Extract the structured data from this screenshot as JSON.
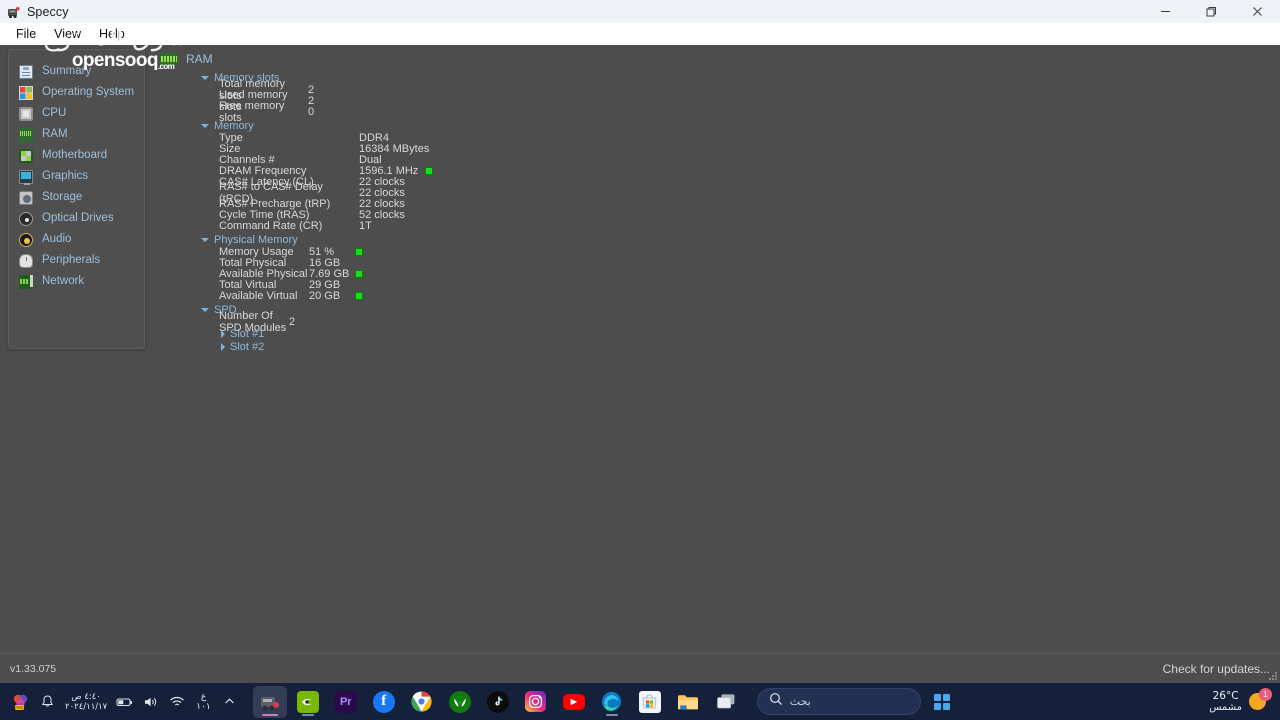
{
  "window": {
    "title": "Speccy",
    "app_icon": "speccy-icon",
    "controls": {
      "minimize": "–",
      "maximize": "❐",
      "close": "✕"
    }
  },
  "menubar": {
    "items": [
      {
        "label": "File"
      },
      {
        "label": "View"
      },
      {
        "label": "Help"
      }
    ]
  },
  "sidebar": {
    "items": [
      {
        "label": "Summary",
        "icon": "summary-icon"
      },
      {
        "label": "Operating System",
        "icon": "operating-system-icon"
      },
      {
        "label": "CPU",
        "icon": "cpu-icon"
      },
      {
        "label": "RAM",
        "icon": "ram-icon"
      },
      {
        "label": "Motherboard",
        "icon": "motherboard-icon"
      },
      {
        "label": "Graphics",
        "icon": "graphics-icon"
      },
      {
        "label": "Storage",
        "icon": "storage-icon"
      },
      {
        "label": "Optical Drives",
        "icon": "optical-drives-icon"
      },
      {
        "label": "Audio",
        "icon": "audio-icon"
      },
      {
        "label": "Peripherals",
        "icon": "peripherals-icon"
      },
      {
        "label": "Network",
        "icon": "network-icon"
      }
    ]
  },
  "content": {
    "page_title": "RAM",
    "page_icon": "ram-icon",
    "groups": {
      "memory_slots": {
        "label": "Memory slots",
        "rows": [
          {
            "key": "Total memory slots",
            "value": "2"
          },
          {
            "key": "Used memory slots",
            "value": "2"
          },
          {
            "key": "Free memory slots",
            "value": "0"
          }
        ]
      },
      "memory": {
        "label": "Memory",
        "rows": [
          {
            "key": "Type",
            "value": "DDR4"
          },
          {
            "key": "Size",
            "value": "16384 MBytes"
          },
          {
            "key": "Channels #",
            "value": "Dual"
          },
          {
            "key": "DRAM Frequency",
            "value": "1596.1 MHz",
            "led": true
          },
          {
            "key": "CAS# Latency (CL)",
            "value": "22 clocks"
          },
          {
            "key": "RAS# to CAS# Delay (tRCD)",
            "value": "22 clocks"
          },
          {
            "key": "RAS# Precharge (tRP)",
            "value": "22 clocks"
          },
          {
            "key": "Cycle Time (tRAS)",
            "value": "52 clocks"
          },
          {
            "key": "Command Rate (CR)",
            "value": "1T"
          }
        ]
      },
      "physical_memory": {
        "label": "Physical Memory",
        "rows": [
          {
            "key": "Memory Usage",
            "value": "51 %",
            "led": true
          },
          {
            "key": "Total Physical",
            "value": "16 GB"
          },
          {
            "key": "Available Physical",
            "value": "7.69 GB",
            "led": true
          },
          {
            "key": "Total Virtual",
            "value": "29 GB"
          },
          {
            "key": "Available Virtual",
            "value": "20 GB",
            "led": true
          }
        ]
      },
      "spd": {
        "label": "SPD",
        "rows": [
          {
            "key": "Number Of SPD Modules",
            "value": "2"
          }
        ],
        "slots": [
          {
            "label": "Slot #1"
          },
          {
            "label": "Slot #2"
          }
        ]
      }
    }
  },
  "statusbar": {
    "version": "v1.33.075",
    "check_updates": "Check for updates..."
  },
  "watermark": {
    "arabic": "السوق المفتوح",
    "english": "opensooq",
    "tld": ".com"
  },
  "taskbar": {
    "tray": [
      {
        "name": "onedrive-photos-icon",
        "glyph": ""
      },
      {
        "name": "notification-bell-icon",
        "glyph": "🔔"
      }
    ],
    "datetime": {
      "time": "٤:٤٠ ص",
      "date": "٢٠٢٤/١١/١٧"
    },
    "status_icons": [
      {
        "name": "battery-icon"
      },
      {
        "name": "volume-icon"
      },
      {
        "name": "wifi-icon"
      }
    ],
    "language": {
      "top": "ع",
      "bottom": "١٠١"
    },
    "show_hidden": "˄",
    "apps": [
      {
        "name": "speccy",
        "label": "",
        "color": "#5c5c66",
        "active": true,
        "running": true
      },
      {
        "name": "nvidia",
        "label": "",
        "color": "#76b900",
        "active": false,
        "running": true
      },
      {
        "name": "premiere-pro",
        "label": "Pr",
        "color": "#2a0a4a",
        "active": false,
        "running": false
      },
      {
        "name": "facebook",
        "label": "f",
        "color": "#1877f2",
        "active": false,
        "running": false
      },
      {
        "name": "chrome",
        "label": "",
        "color": "#ffffff",
        "active": false,
        "running": false
      },
      {
        "name": "xbox",
        "label": "",
        "color": "#107c10",
        "active": false,
        "running": false
      },
      {
        "name": "tiktok",
        "label": "♪",
        "color": "#0c0c0c",
        "active": false,
        "running": false
      },
      {
        "name": "instagram",
        "label": "",
        "color": "#c13584",
        "active": false,
        "running": false
      },
      {
        "name": "youtube",
        "label": "▶",
        "color": "#ff0000",
        "active": false,
        "running": false
      },
      {
        "name": "edge",
        "label": "",
        "color": "#0b7cc1",
        "active": false,
        "running": true
      },
      {
        "name": "microsoft-store",
        "label": "",
        "color": "#f2f6fb",
        "active": false,
        "running": false
      },
      {
        "name": "file-explorer",
        "label": "",
        "color": "#ffc75a",
        "active": false,
        "running": false
      },
      {
        "name": "task-view",
        "label": "",
        "color": "#c9d2de",
        "active": false,
        "running": false
      }
    ],
    "search": {
      "placeholder": "بحث",
      "icon": "search-icon"
    },
    "start": {
      "name": "start-button"
    },
    "weather": {
      "temperature": "26°C",
      "condition": "مشمس",
      "badge": "1",
      "icon": "sun-icon"
    }
  },
  "colors": {
    "window_bg": "#4d4d4d",
    "titlebar_bg": "#eff3f7",
    "menubar_bg": "#ffffff",
    "link_blue": "#9cc0de",
    "text_light": "#d9d9d9",
    "led_green": "#12e012",
    "taskbar_bg": "#15213a"
  }
}
